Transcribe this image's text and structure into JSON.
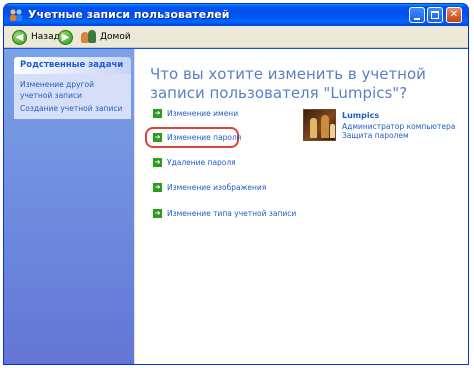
{
  "window": {
    "title": "Учетные записи пользователей",
    "minimize_label": "_",
    "maximize_label": "",
    "close_label": "✕"
  },
  "toolbar": {
    "back_label": "Назад",
    "home_label": "Домой"
  },
  "sidebar": {
    "header": "Родственные задачи",
    "items": [
      {
        "label": "Изменение другой учетной записи"
      },
      {
        "label": "Создание учетной записи"
      }
    ]
  },
  "main": {
    "heading": "Что вы хотите изменить в учетной записи пользователя \"Lumpics\"?",
    "options": [
      {
        "label": "Изменение имени"
      },
      {
        "label": "Изменение пароля",
        "highlighted": true
      },
      {
        "label": "Удаление пароля"
      },
      {
        "label": "Изменение изображения"
      },
      {
        "label": "Изменение типа учетной записи"
      }
    ],
    "account": {
      "name": "Lumpics",
      "role": "Администратор компьютера",
      "status": "Защита паролем"
    }
  },
  "icons": {
    "back": "back-arrow-icon",
    "forward": "forward-arrow-icon",
    "home": "user-accounts-home-icon",
    "option": "green-arrow-icon",
    "highlight_color": "#d8433b"
  }
}
